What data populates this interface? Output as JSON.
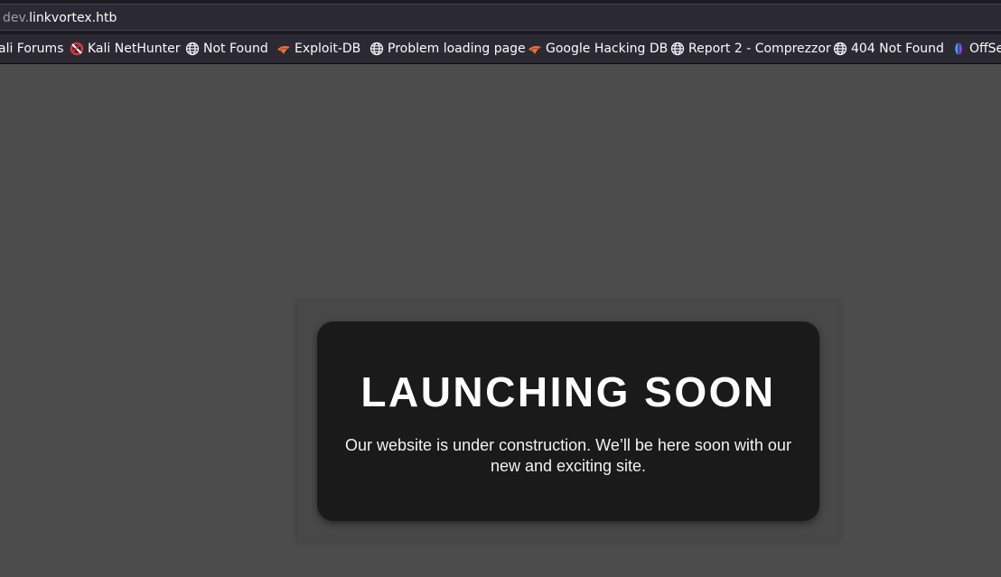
{
  "browser": {
    "url": {
      "subdomain": "dev.",
      "host": "linkvortex.htb"
    },
    "bookmarks": [
      {
        "label": "ali Forums",
        "icon": "none"
      },
      {
        "label": "Kali NetHunter",
        "icon": "kali-nethunter-icon"
      },
      {
        "label": "Not Found",
        "icon": "globe-icon"
      },
      {
        "label": "Exploit-DB",
        "icon": "exploit-db-icon"
      },
      {
        "label": "Problem loading page",
        "icon": "globe-icon"
      },
      {
        "label": "Google Hacking DB",
        "icon": "exploit-db-icon"
      },
      {
        "label": "Report 2 - Comprezzor",
        "icon": "globe-icon"
      },
      {
        "label": "404 Not Found",
        "icon": "globe-icon"
      },
      {
        "label": "OffSe",
        "icon": "offsec-icon"
      }
    ]
  },
  "page": {
    "title": "LAUNCHING SOON",
    "message": "Our website is under construction. We’ll be here soon with our new and exciting site."
  },
  "colors": {
    "page_background": "#4c4c4c",
    "card_background": "#1a1a1b",
    "toolbar_background": "#2b2a33"
  }
}
